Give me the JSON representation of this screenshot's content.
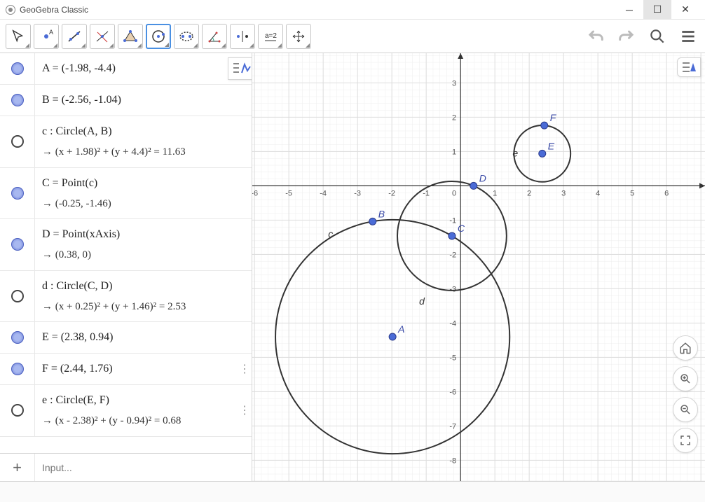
{
  "window": {
    "title": "GeoGebra Classic"
  },
  "toolbar": {
    "undo_disabled": true,
    "redo_disabled": true
  },
  "algebra": {
    "input_placeholder": "Input...",
    "rows": [
      {
        "kind": "point",
        "label": "A = (-1.98, -4.4)",
        "sub": ""
      },
      {
        "kind": "point",
        "label": "B = (-2.56, -1.04)",
        "sub": ""
      },
      {
        "kind": "circle",
        "label": "c : Circle(A, B)",
        "sub": "→  (x + 1.98)² + (y + 4.4)² = 11.63"
      },
      {
        "kind": "point",
        "label": "C = Point(c)",
        "sub": "→  (-0.25, -1.46)"
      },
      {
        "kind": "point",
        "label": "D = Point(xAxis)",
        "sub": "→  (0.38, 0)"
      },
      {
        "kind": "circle",
        "label": "d : Circle(C, D)",
        "sub": "→  (x + 0.25)² + (y + 1.46)² = 2.53"
      },
      {
        "kind": "point",
        "label": "E = (2.38, 0.94)",
        "sub": ""
      },
      {
        "kind": "point",
        "label": "F = (2.44, 1.76)",
        "sub": "",
        "dots": true
      },
      {
        "kind": "circle",
        "label": "e : Circle(E, F)",
        "sub": "→  (x - 2.38)² + (y - 0.94)² = 0.68",
        "dots": true
      }
    ]
  },
  "graph": {
    "x_range": [
      -6,
      6
    ],
    "y_range": [
      -8,
      3
    ],
    "points": {
      "A": {
        "x": -1.98,
        "y": -4.4,
        "label": "A"
      },
      "B": {
        "x": -2.56,
        "y": -1.04,
        "label": "B"
      },
      "C": {
        "x": -0.25,
        "y": -1.46,
        "label": "C"
      },
      "D": {
        "x": 0.38,
        "y": 0,
        "label": "D"
      },
      "E": {
        "x": 2.38,
        "y": 0.94,
        "label": "E"
      },
      "F": {
        "x": 2.44,
        "y": 1.76,
        "label": "F"
      }
    },
    "circles": {
      "c": {
        "cx": -1.98,
        "cy": -4.4,
        "r2": 11.63,
        "label": "c"
      },
      "d": {
        "cx": -0.25,
        "cy": -1.46,
        "r2": 2.53,
        "label": "d"
      },
      "e": {
        "cx": 2.38,
        "cy": 0.94,
        "r2": 0.68,
        "label": "e"
      }
    }
  },
  "chart_data": {
    "type": "scatter",
    "title": "",
    "xlabel": "",
    "ylabel": "",
    "xlim": [
      -6,
      6
    ],
    "ylim": [
      -8,
      3
    ],
    "series": [
      {
        "name": "points",
        "values": [
          [
            -1.98,
            -4.4
          ],
          [
            -2.56,
            -1.04
          ],
          [
            -0.25,
            -1.46
          ],
          [
            0.38,
            0
          ],
          [
            2.38,
            0.94
          ],
          [
            2.44,
            1.76
          ]
        ]
      }
    ],
    "circles": [
      {
        "name": "c",
        "cx": -1.98,
        "cy": -4.4,
        "r": 3.41
      },
      {
        "name": "d",
        "cx": -0.25,
        "cy": -1.46,
        "r": 1.59
      },
      {
        "name": "e",
        "cx": 2.38,
        "cy": 0.94,
        "r": 0.82
      }
    ]
  }
}
